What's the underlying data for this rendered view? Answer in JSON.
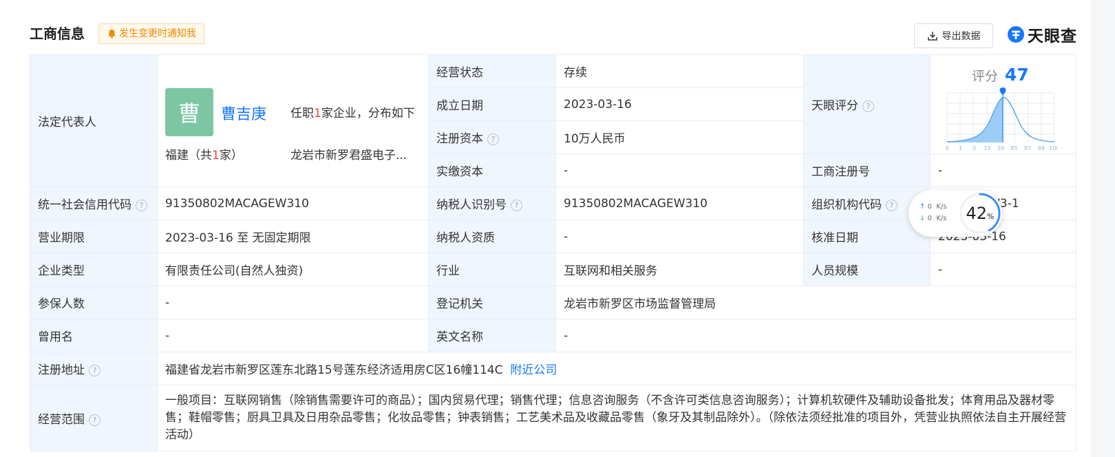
{
  "header": {
    "title": "工商信息",
    "notify_label": "发生变更时通知我",
    "export_label": "导出数据",
    "brand": "天眼查"
  },
  "legal_rep": {
    "label": "法定代表人",
    "avatar_char": "曹",
    "name": "曹吉庚",
    "jobs_prefix": "任职",
    "jobs_count": "1",
    "jobs_suffix": "家企业，分布如下",
    "region_prefix": "福建（共",
    "region_count": "1",
    "region_suffix": "家）",
    "company": "龙岩市新罗君盛电子..."
  },
  "status": {
    "label": "经营状态",
    "value": "存续"
  },
  "founded": {
    "label": "成立日期",
    "value": "2023-03-16"
  },
  "reg_capital": {
    "label": "注册资本",
    "value": "10万人民币"
  },
  "paid_capital": {
    "label": "实缴资本",
    "value": "-"
  },
  "score": {
    "label": "天眼评分",
    "head_label": "评分",
    "value": "47",
    "axis": [
      "0",
      "1",
      "3",
      "15",
      "50",
      "85",
      "97",
      "99",
      "100"
    ]
  },
  "biz_reg_no": {
    "label": "工商注册号",
    "value": "-"
  },
  "credit_code": {
    "label": "统一社会信用代码",
    "value": "91350802MACAGEW310"
  },
  "taxpayer_id": {
    "label": "纳税人识别号",
    "value": "91350802MACAGEW310"
  },
  "org_code": {
    "label": "组织机构代码",
    "value": "MACAGEW3-1"
  },
  "term": {
    "label": "营业期限",
    "value": "2023-03-16 至 无固定期限"
  },
  "taxpayer_qual": {
    "label": "纳税人资质",
    "value": "-"
  },
  "approve_date": {
    "label": "核准日期",
    "value": "2023-03-16"
  },
  "company_type": {
    "label": "企业类型",
    "value": "有限责任公司(自然人独资)"
  },
  "industry": {
    "label": "行业",
    "value": "互联网和相关服务"
  },
  "staff_size": {
    "label": "人员规模",
    "value": "-"
  },
  "insured": {
    "label": "参保人数",
    "value": "-"
  },
  "reg_authority": {
    "label": "登记机关",
    "value": "龙岩市新罗区市场监督管理局"
  },
  "former_name": {
    "label": "曾用名",
    "value": "-"
  },
  "english_name": {
    "label": "英文名称",
    "value": "-"
  },
  "address": {
    "label": "注册地址",
    "value": "福建省龙岩市新罗区莲东北路15号莲东经济适用房C区16幢114C",
    "link": "附近公司"
  },
  "scope": {
    "label": "经营范围",
    "value": "一般项目：互联网销售（除销售需要许可的商品）；国内贸易代理；销售代理；信息咨询服务（不含许可类信息咨询服务）；计算机软硬件及辅助设备批发；体育用品及器材零售；鞋帽零售；厨具卫具及日用杂品零售；化妆品零售；钟表销售；工艺美术品及收藏品零售（象牙及其制品除外）。（除依法须经批准的项目外，凭营业执照依法自主开展经营活动）"
  },
  "speed_widget": {
    "up_value": "0",
    "down_value": "0",
    "unit": "K/s",
    "percent": "42",
    "percent_sign": "%"
  },
  "colors": {
    "accent": "#1677ff",
    "label_bg": "#f0f6fd",
    "notify": "#f08a00",
    "avatar": "#7cc6a4"
  }
}
